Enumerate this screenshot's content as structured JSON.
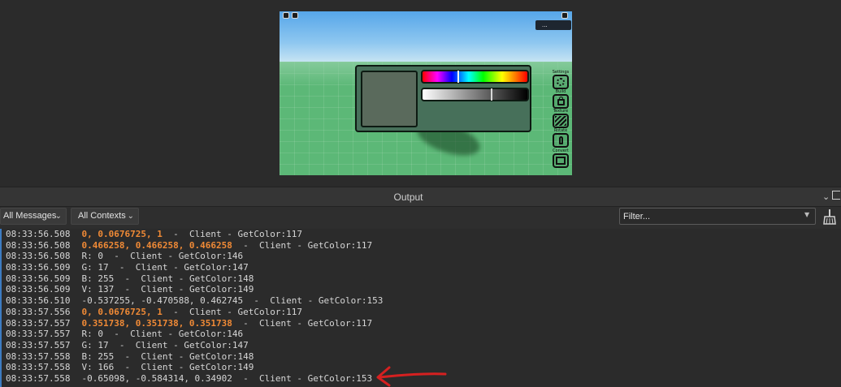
{
  "game_view": {
    "player_badge": "...",
    "color_picker": {
      "preview_color": "#5a6a5c",
      "hue_position": 0.33,
      "value_position": 0.65
    },
    "side_tools": [
      {
        "label": "Settings",
        "icon": "gear-icon"
      },
      {
        "label": "Build",
        "icon": "bag-icon"
      },
      {
        "label": "Texture",
        "icon": "texture-icon"
      },
      {
        "label": "Rotate",
        "icon": "figure-icon"
      },
      {
        "label": "Convert",
        "icon": "dashed-square-icon"
      }
    ]
  },
  "output": {
    "title": "Output",
    "messages_filter": "All Messages",
    "contexts_filter": "All Contexts",
    "filter_placeholder": "Filter...",
    "lines": [
      {
        "ts": "08:33:56.508",
        "msg": "0, 0.0676725, 1",
        "highlight": true,
        "src": "  -  Client - GetColor:117"
      },
      {
        "ts": "08:33:56.508",
        "msg": "0.466258, 0.466258, 0.466258",
        "highlight": true,
        "src": "  -  Client - GetColor:117"
      },
      {
        "ts": "08:33:56.508",
        "msg": "R: 0",
        "highlight": false,
        "src": "  -  Client - GetColor:146"
      },
      {
        "ts": "08:33:56.509",
        "msg": "G: 17",
        "highlight": false,
        "src": "  -  Client - GetColor:147"
      },
      {
        "ts": "08:33:56.509",
        "msg": "B: 255",
        "highlight": false,
        "src": "  -  Client - GetColor:148"
      },
      {
        "ts": "08:33:56.509",
        "msg": "V: 137",
        "highlight": false,
        "src": "  -  Client - GetColor:149"
      },
      {
        "ts": "08:33:56.510",
        "msg": "-0.537255, -0.470588, 0.462745",
        "highlight": false,
        "src": "  -  Client - GetColor:153"
      },
      {
        "ts": "08:33:57.556",
        "msg": "0, 0.0676725, 1",
        "highlight": true,
        "src": "  -  Client - GetColor:117"
      },
      {
        "ts": "08:33:57.557",
        "msg": "0.351738, 0.351738, 0.351738",
        "highlight": true,
        "src": "  -  Client - GetColor:117"
      },
      {
        "ts": "08:33:57.557",
        "msg": "R: 0",
        "highlight": false,
        "src": "  -  Client - GetColor:146"
      },
      {
        "ts": "08:33:57.557",
        "msg": "G: 17",
        "highlight": false,
        "src": "  -  Client - GetColor:147"
      },
      {
        "ts": "08:33:57.558",
        "msg": "B: 255",
        "highlight": false,
        "src": "  -  Client - GetColor:148"
      },
      {
        "ts": "08:33:57.558",
        "msg": "V: 166",
        "highlight": false,
        "src": "  -  Client - GetColor:149"
      },
      {
        "ts": "08:33:57.558",
        "msg": "-0.65098, -0.584314, 0.34902",
        "highlight": false,
        "src": "  -  Client - GetColor:153"
      }
    ]
  },
  "colors": {
    "highlight_text": "#f08a36",
    "annotation_arrow": "#d62020"
  }
}
